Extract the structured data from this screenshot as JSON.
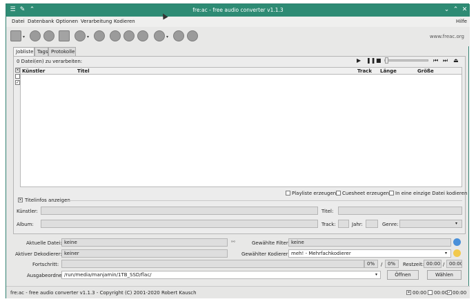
{
  "window": {
    "title": "fre:ac - free audio converter v1.1.3",
    "controls": [
      "chevron-down-icon",
      "chevron-up-icon",
      "close-icon"
    ]
  },
  "menubar": {
    "items": [
      "Datei",
      "Datenbank",
      "Optionen",
      "Verarbeitung",
      "Kodieren"
    ],
    "help": "Hilfe"
  },
  "toolbar": {
    "link": "www.freac.org"
  },
  "tabs": [
    "Jobliste",
    "Tags",
    "Protokolle"
  ],
  "joblist": {
    "count_text": "0 Datei(en) zu verarbeiten:",
    "columns": [
      "Künstler",
      "Titel",
      "Track",
      "Länge",
      "Größe"
    ]
  },
  "options": {
    "playlist": "Playliste erzeugen",
    "cuesheet": "Cuesheet erzeugen",
    "single_file": "In eine einzige Datei kodieren"
  },
  "titleinfo": {
    "toggle": "Titelinfos anzeigen",
    "artist": "Künstler:",
    "title": "Titel:",
    "album": "Album:",
    "track": "Track:",
    "year": "Jahr:",
    "genre": "Genre:"
  },
  "status": {
    "current_file_label": "Aktuelle Datei:",
    "current_file_value": "keine",
    "decoder_label": "Aktiver Dekodierer:",
    "decoder_value": "keiner",
    "progress_label": "Fortschritt:",
    "progress_pct_1": "0%",
    "progress_pct_2": "0%",
    "remaining_label": "Restzeit:",
    "remaining_1": "00:00",
    "remaining_2": "00:00",
    "filter_label": "Gewählte Filter:",
    "filter_value": "keine",
    "encoder_label": "Gewählter Kodierer:",
    "encoder_value": "meh! - Mehrfachkodierer",
    "output_label": "Ausgabeordner:",
    "output_value": "/run/media/manjamin/1TB_SSD/flac/",
    "open_button": "Öffnen",
    "choose_button": "Wählen"
  },
  "statusbar": {
    "text": "fre:ac - free audio converter v1.1.3 - Copyright (C) 2001-2020 Robert Kausch",
    "timers": [
      "00:00",
      "00:00",
      "00:00"
    ]
  }
}
